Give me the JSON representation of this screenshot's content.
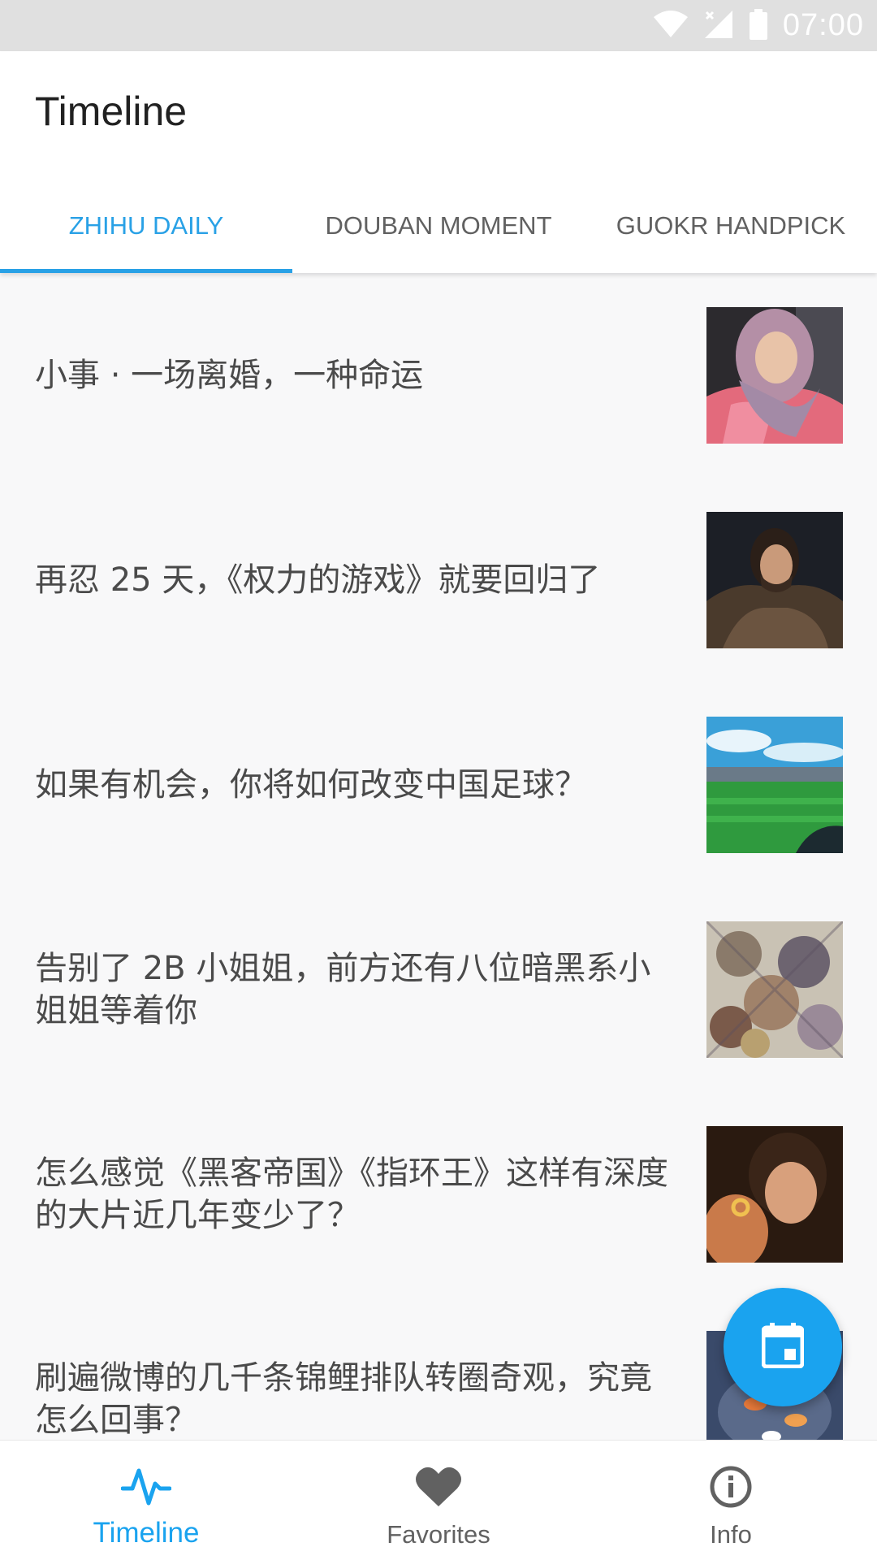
{
  "status_bar": {
    "time": "07:00",
    "icons": [
      "wifi-icon",
      "cellular-no-signal-icon",
      "battery-icon"
    ]
  },
  "app_bar": {
    "title": "Timeline"
  },
  "tabs": [
    {
      "label": "ZHIHU DAILY",
      "active": true
    },
    {
      "label": "DOUBAN MOMENT",
      "active": false
    },
    {
      "label": "GUOKR HANDPICK",
      "active": false
    }
  ],
  "list": {
    "items": [
      {
        "title": "小事 · 一场离婚，一种命运",
        "thumbnail": "woman-in-headscarf-photo"
      },
      {
        "title": "再忍 25 天，《权力的游戏》就要回归了",
        "thumbnail": "man-in-fur-cloak-photo"
      },
      {
        "title": "如果有机会，你将如何改变中国足球？",
        "thumbnail": "football-stadium-photo"
      },
      {
        "title": "告别了 2B 小姐姐，前方还有八位暗黑系小姐姐等着你",
        "thumbnail": "anime-characters-artwork"
      },
      {
        "title": "怎么感觉《黑客帝国》《指环王》这样有深度的大片近几年变少了？",
        "thumbnail": "hobbit-holding-ring-photo"
      },
      {
        "title": "刷遍微博的几千条锦鲤排队转圈奇观，究竟怎么回事？",
        "thumbnail": "koi-fish-photo"
      }
    ]
  },
  "fab": {
    "icon": "calendar-icon"
  },
  "bottom_nav": {
    "items": [
      {
        "label": "Timeline",
        "icon": "pulse-icon",
        "active": true
      },
      {
        "label": "Favorites",
        "icon": "heart-icon",
        "active": false
      },
      {
        "label": "Info",
        "icon": "info-icon",
        "active": false
      }
    ]
  },
  "colors": {
    "accent": "#29a1e6",
    "fab": "#1aa3ef",
    "status_bar": "#e0e0e0",
    "text_primary": "#212121",
    "text_secondary": "#616161"
  }
}
